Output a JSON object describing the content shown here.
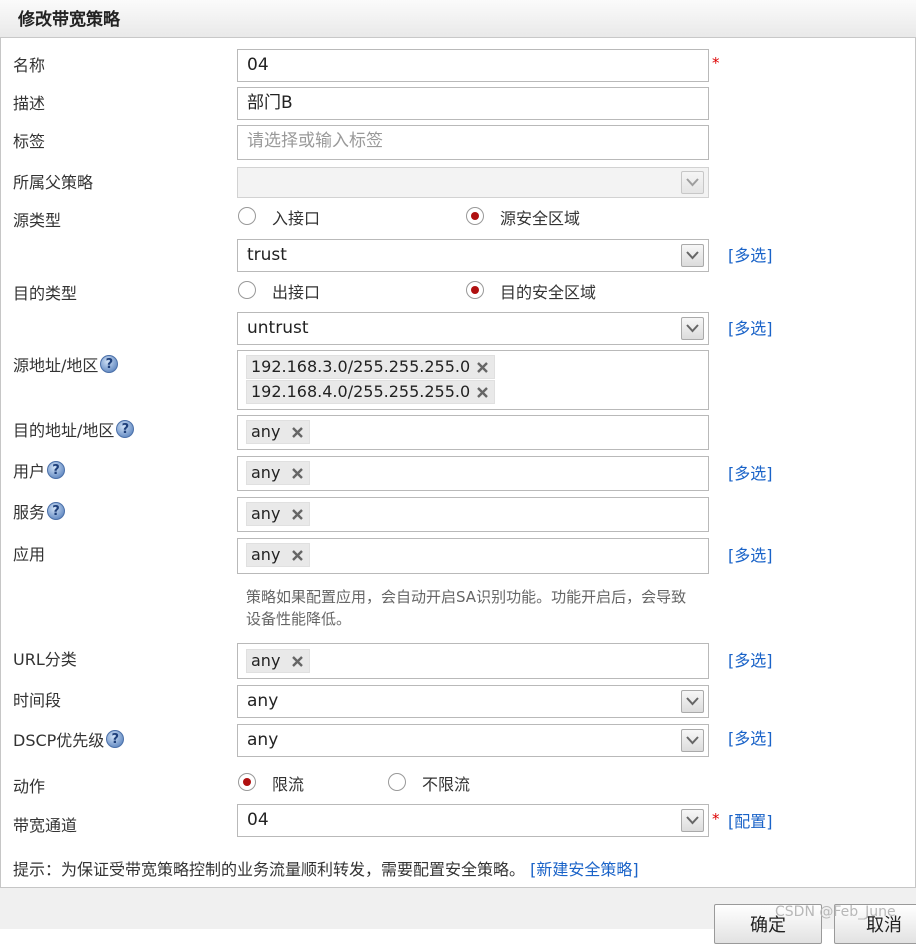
{
  "dialog": {
    "title": "修改带宽策略"
  },
  "form": {
    "name": {
      "label": "名称",
      "value": "04"
    },
    "description": {
      "label": "描述",
      "value": "部门B"
    },
    "tags": {
      "label": "标签",
      "placeholder": "请选择或输入标签"
    },
    "parent_policy": {
      "label": "所属父策略",
      "value": ""
    },
    "source_type": {
      "label": "源类型",
      "options": [
        "入接口",
        "源安全区域"
      ],
      "selected": "源安全区域",
      "zone_value": "trust",
      "multi_link": "[多选]"
    },
    "dest_type": {
      "label": "目的类型",
      "options": [
        "出接口",
        "目的安全区域"
      ],
      "selected": "目的安全区域",
      "zone_value": "untrust",
      "multi_link": "[多选]"
    },
    "source_address": {
      "label": "源地址/地区",
      "tags": [
        "192.168.3.0/255.255.255.0",
        "192.168.4.0/255.255.255.0"
      ]
    },
    "dest_address": {
      "label": "目的地址/地区",
      "tags": [
        "any"
      ]
    },
    "user": {
      "label": "用户",
      "tags": [
        "any"
      ],
      "multi_link": "[多选]"
    },
    "service": {
      "label": "服务",
      "tags": [
        "any"
      ]
    },
    "application": {
      "label": "应用",
      "tags": [
        "any"
      ],
      "multi_link": "[多选]",
      "note": "策略如果配置应用，会自动开启SA识别功能。功能开启后，会导致设备性能降低。"
    },
    "url_category": {
      "label": "URL分类",
      "tags": [
        "any"
      ],
      "multi_link": "[多选]"
    },
    "time_range": {
      "label": "时间段",
      "value": "any"
    },
    "dscp": {
      "label": "DSCP优先级",
      "value": "any",
      "multi_link": "[多选]"
    },
    "action": {
      "label": "动作",
      "options": [
        "限流",
        "不限流"
      ],
      "selected": "限流"
    },
    "bandwidth_channel": {
      "label": "带宽通道",
      "value": "04",
      "config_link": "[配置]"
    }
  },
  "tip": {
    "text": "提示：为保证受带宽策略控制的业务流量顺利转发，需要配置安全策略。",
    "link": "[新建安全策略]"
  },
  "buttons": {
    "ok": "确定",
    "cancel": "取消"
  },
  "watermark": "CSDN @Feb_June",
  "colors": {
    "link": "#1a63c8",
    "radio_selected": "#b01010",
    "required": "#dd0000"
  },
  "icons": {
    "help": "question-circle-icon",
    "remove": "x-icon",
    "dropdown": "chevron-down-icon"
  }
}
